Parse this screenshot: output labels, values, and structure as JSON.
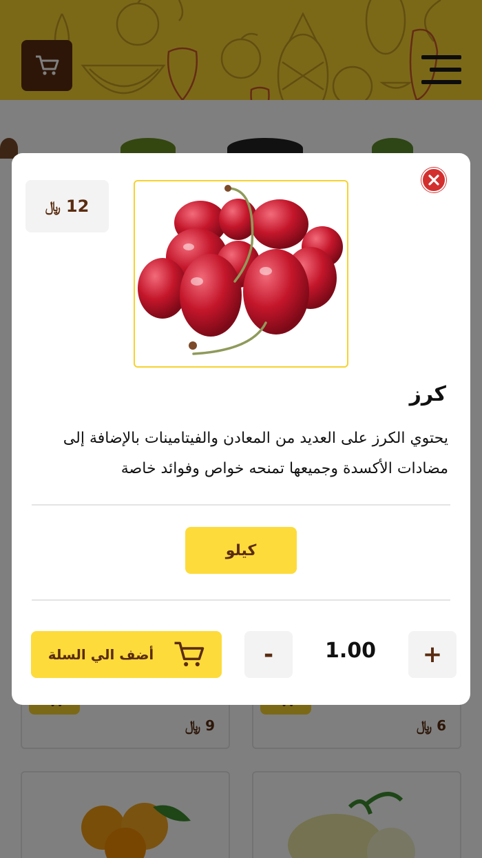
{
  "colors": {
    "brand_yellow": "#f6d230",
    "brand_brown": "#5a2c10",
    "close_red": "#d32f2f"
  },
  "header": {
    "cart_icon": "cart-icon",
    "menu_icon": "hamburger-menu-icon"
  },
  "background_cards": [
    {
      "price": "9 ﷼"
    },
    {
      "price": "6 ﷼"
    }
  ],
  "modal": {
    "close_icon": "close-icon",
    "price": {
      "amount": "12",
      "currency": "﷼"
    },
    "product": {
      "name": "كرز",
      "description": "يحتوي الكرز على العديد من المعادن والفيتامينات بالإضافة إلى مضادات الأكسدة وجميعها تمنحه خواص وفوائد خاصة",
      "image": "cherries"
    },
    "unit_option": "كيلو",
    "quantity": {
      "increment_label": "+",
      "decrement_label": "-",
      "value": "1.00"
    },
    "add_to_cart": {
      "label": "أضف الي السلة",
      "icon": "cart-icon"
    }
  }
}
